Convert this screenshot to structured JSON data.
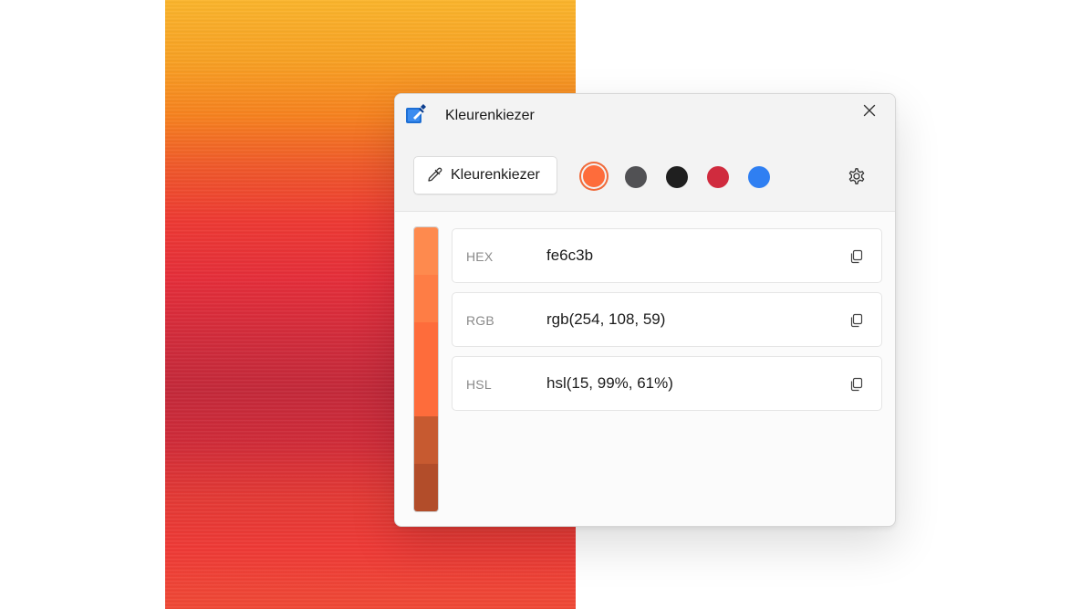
{
  "window": {
    "title": "Kleurenkiezer",
    "icon": "color-picker-app-icon",
    "close_icon": "close-icon"
  },
  "toolbar": {
    "picker_button_label": "Kleurenkiezer",
    "picker_icon": "eyedropper-icon",
    "settings_icon": "gear-icon"
  },
  "swatches": [
    {
      "color": "#fe6c3b",
      "selected": true
    },
    {
      "color": "#515154",
      "selected": false
    },
    {
      "color": "#1f1f1f",
      "selected": false
    },
    {
      "color": "#d02b3e",
      "selected": false
    },
    {
      "color": "#2f7ff2",
      "selected": false
    }
  ],
  "palette": [
    "#fe8a4e",
    "#fe7d45",
    "#fe6c3b",
    "#fe6c3b",
    "#c75a30",
    "#b24d2a"
  ],
  "formats": [
    {
      "name": "HEX",
      "value": "fe6c3b",
      "copy_icon": "copy-icon"
    },
    {
      "name": "RGB",
      "value": "rgb(254, 108, 59)",
      "copy_icon": "copy-icon"
    },
    {
      "name": "HSL",
      "value": "hsl(15, 99%, 61%)",
      "copy_icon": "copy-icon"
    }
  ]
}
